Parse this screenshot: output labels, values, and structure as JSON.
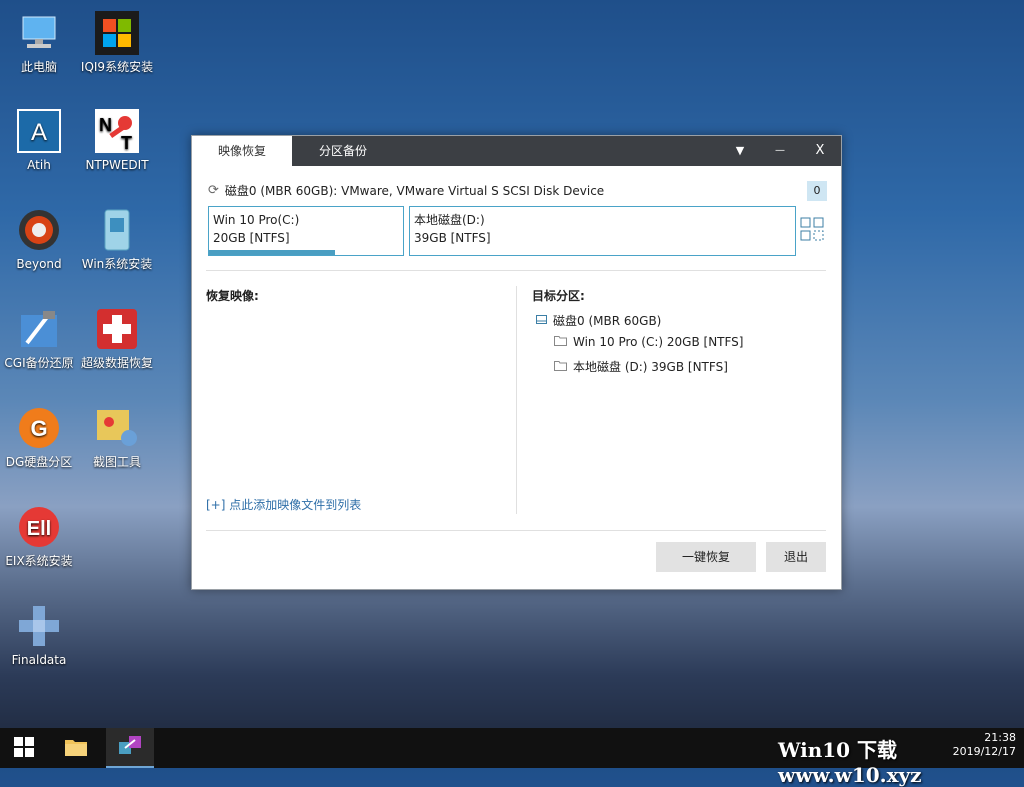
{
  "desktop": {
    "icons": [
      {
        "label": "此电脑",
        "icon": "computer-icon"
      },
      {
        "label": "IQI9系统安装",
        "icon": "windows-logo-icon"
      },
      {
        "label": "Atih",
        "icon": "letter-a-icon"
      },
      {
        "label": "NTPWEDIT",
        "icon": "nt-key-icon"
      },
      {
        "label": "Beyond",
        "icon": "beyond-icon"
      },
      {
        "label": "Win系统安装",
        "icon": "win-install-icon"
      },
      {
        "label": "CGI备份还原",
        "icon": "cgi-icon"
      },
      {
        "label": "超级数据恢复",
        "icon": "data-recovery-icon"
      },
      {
        "label": "DG硬盘分区",
        "icon": "diskgenius-icon"
      },
      {
        "label": "截图工具",
        "icon": "snip-icon"
      },
      {
        "label": "EIX系统安装",
        "icon": "eix-icon"
      },
      {
        "label": "Finaldata",
        "icon": "finaldata-icon"
      }
    ]
  },
  "window": {
    "tabs": [
      "映像恢复",
      "分区备份"
    ],
    "controls": {
      "dropdown": "▼",
      "minimize": "—",
      "close": "X"
    },
    "disk_header": "磁盘0 (MBR 60GB): VMware, VMware Virtual S SCSI Disk Device",
    "disk_index": "0",
    "partitions": [
      {
        "name": "Win 10 Pro(C:)",
        "size": "20GB [NTFS]",
        "used_fraction": 0.63
      },
      {
        "name": "本地磁盘(D:)",
        "size": "39GB [NTFS]",
        "used_fraction": 0
      }
    ],
    "restore_image_title": "恢复映像:",
    "target_partition_title": "目标分区:",
    "tree": {
      "disk": "磁盘0 (MBR 60GB)",
      "children": [
        "Win 10 Pro (C:) 20GB [NTFS]",
        "本地磁盘 (D:) 39GB [NTFS]"
      ]
    },
    "add_image_link": "[+] 点此添加映像文件到列表",
    "buttons": {
      "restore": "一键恢复",
      "exit": "退出"
    }
  },
  "taskbar": {
    "clock_time": "21:38",
    "clock_date": "2019/12/17",
    "watermark": "Win10 下载 www.w10.xyz"
  },
  "colors": {
    "accent": "#4a9ec2",
    "titlebar": "#3c3f44",
    "link": "#2f6fa8"
  }
}
